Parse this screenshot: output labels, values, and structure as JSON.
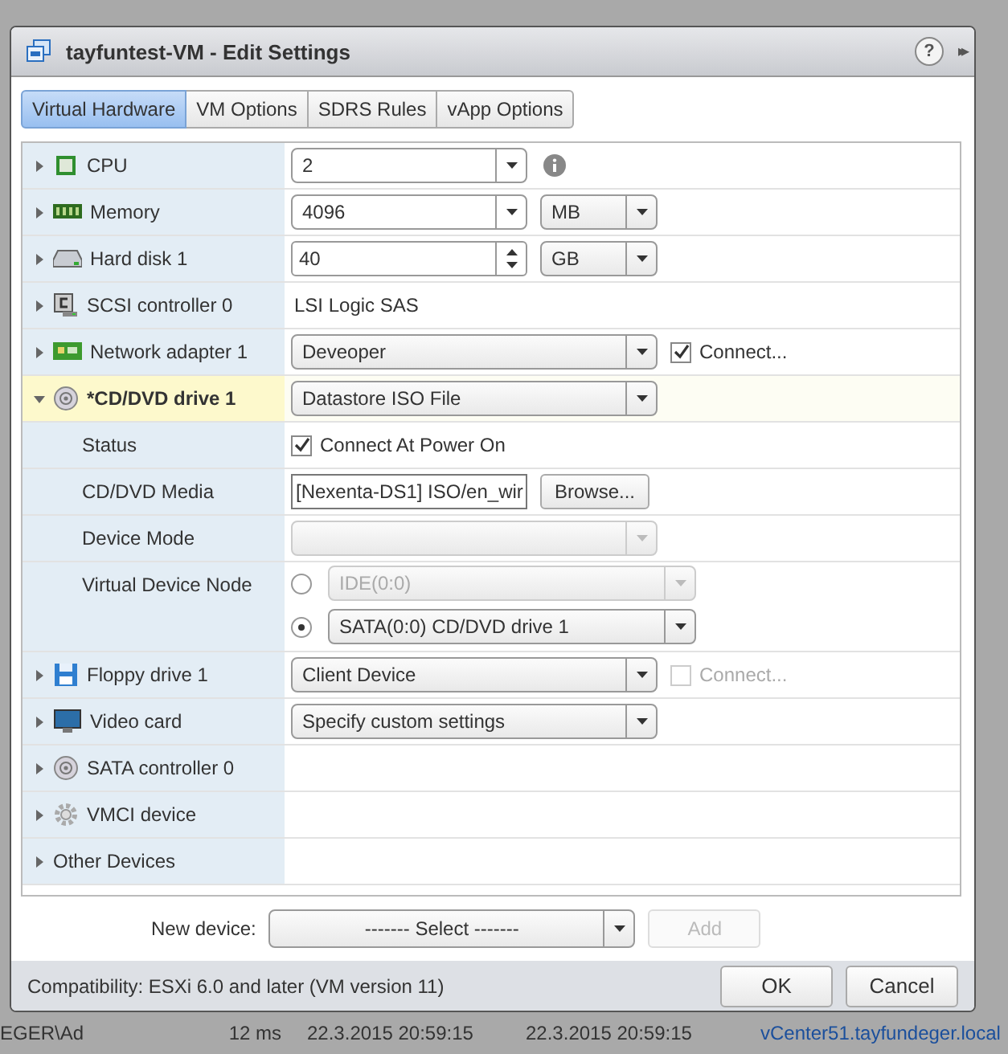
{
  "window": {
    "title": "tayfuntest-VM - Edit Settings",
    "help": "?",
    "collapse": "▸▸"
  },
  "tabs": [
    {
      "label": "Virtual Hardware",
      "selected": true
    },
    {
      "label": "VM Options",
      "selected": false
    },
    {
      "label": "SDRS Rules",
      "selected": false
    },
    {
      "label": "vApp Options",
      "selected": false
    }
  ],
  "devices": [
    {
      "label": "CPU",
      "kind": "cpu",
      "expanded": false,
      "modified": false,
      "controls": [
        {
          "kind": "combo",
          "value": "2"
        },
        {
          "kind": "info"
        }
      ]
    },
    {
      "label": "Memory",
      "kind": "memory",
      "expanded": false,
      "modified": false,
      "controls": [
        {
          "kind": "combo",
          "value": "4096"
        },
        {
          "kind": "unit",
          "value": "MB"
        }
      ]
    },
    {
      "label": "Hard disk 1",
      "kind": "disk",
      "expanded": false,
      "modified": false,
      "controls": [
        {
          "kind": "spin",
          "value": "40"
        },
        {
          "kind": "unit",
          "value": "GB"
        }
      ]
    },
    {
      "label": "SCSI controller 0",
      "kind": "controller",
      "expanded": false,
      "modified": false,
      "controls": [
        {
          "kind": "text",
          "value": "LSI Logic SAS"
        }
      ]
    },
    {
      "label": "Network adapter 1",
      "kind": "network",
      "expanded": false,
      "modified": false,
      "controls": [
        {
          "kind": "select",
          "value": "Deveoper",
          "disabled": false
        },
        {
          "kind": "check",
          "label": "Connect...",
          "checked": true,
          "disabled": false
        }
      ]
    },
    {
      "label": "*CD/DVD drive 1",
      "kind": "cdrom",
      "expanded": true,
      "modified": true,
      "controls": [
        {
          "kind": "select",
          "value": "Datastore ISO File",
          "disabled": false
        }
      ],
      "children": [
        {
          "label": "Status",
          "controls": [
            {
              "kind": "check",
              "label": "Connect At Power On",
              "checked": true,
              "disabled": false
            }
          ]
        },
        {
          "label": "CD/DVD Media",
          "controls": [
            {
              "kind": "field",
              "value": "[Nexenta-DS1] ISO/en_wir"
            },
            {
              "kind": "button",
              "label": "Browse..."
            }
          ]
        },
        {
          "label": "Device Mode",
          "controls": [
            {
              "kind": "select",
              "disabled": true
            }
          ]
        },
        {
          "label": "Virtual Device Node",
          "controls": [
            {
              "kind": "radios",
              "options": [
                {
                  "value": "IDE(0:0)",
                  "selected": false
                },
                {
                  "value": "SATA(0:0) CD/DVD drive 1",
                  "selected": true
                }
              ]
            }
          ]
        }
      ]
    },
    {
      "label": "Floppy drive 1",
      "kind": "floppy",
      "expanded": false,
      "modified": false,
      "controls": [
        {
          "kind": "select",
          "value": "Client Device",
          "disabled": false
        },
        {
          "kind": "check",
          "label": "Connect...",
          "checked": false,
          "disabled": true
        }
      ]
    },
    {
      "label": "Video card",
      "kind": "video",
      "expanded": false,
      "modified": false,
      "controls": [
        {
          "kind": "select",
          "value": "Specify custom settings",
          "disabled": false
        }
      ]
    },
    {
      "label": "SATA controller 0",
      "kind": "sata",
      "expanded": false,
      "modified": false
    },
    {
      "label": "VMCI device",
      "kind": "vmci",
      "expanded": false,
      "modified": false
    },
    {
      "label": "Other Devices",
      "kind": "other",
      "expanded": false,
      "modified": false
    }
  ],
  "new_device": {
    "label": "New device:",
    "value": "------- Select -------",
    "button": "Add",
    "button_disabled": true
  },
  "compatibility": "Compatibility: ESXi 6.0 and later (VM version 11)",
  "buttons": [
    "OK",
    "Cancel"
  ],
  "background_row": [
    "EGER\\Ad",
    "12 ms",
    "22.3.2015 20:59:15",
    "22.3.2015 20:59:15",
    "vCenter51.tayfundeger.local"
  ]
}
